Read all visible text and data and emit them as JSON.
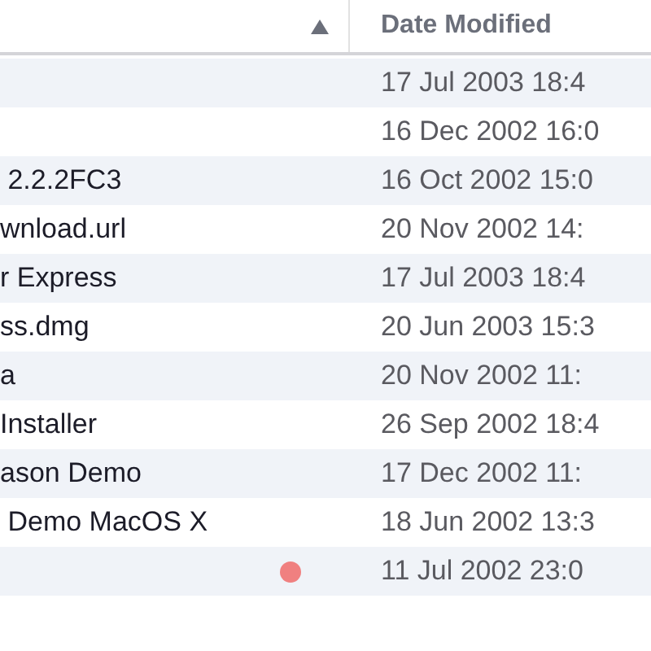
{
  "table": {
    "columns": [
      {
        "sorted": true
      },
      {
        "label": "Date Modified",
        "sorted": false
      }
    ],
    "rows": [
      {
        "date": "17 Jul 2003 18:4"
      },
      {
        "date": "16 Dec 2002 16:0"
      },
      {
        "name": " 2.2.2FC3",
        "date": "16 Oct 2002 15:0"
      },
      {
        "name": "wnload.url",
        "date": "20 Nov 2002 14:"
      },
      {
        "name": "r Express",
        "date": "17 Jul 2003 18:4"
      },
      {
        "name": "ss.dmg",
        "date": "20 Jun 2003 15:3"
      },
      {
        "name": "a",
        "date": "20 Nov 2002 11:"
      },
      {
        "name": "Installer",
        "date": "26 Sep 2002 18:4"
      },
      {
        "name": "ason Demo",
        "date": "17 Dec 2002 11:"
      },
      {
        "name": " Demo MacOS X",
        "date": "18 Jun 2002 13:3"
      },
      {
        "date": "11 Jul 2002 23:0",
        "color": "#f08080"
      }
    ]
  }
}
